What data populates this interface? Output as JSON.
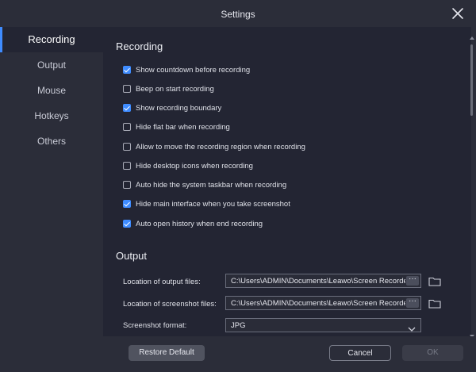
{
  "window": {
    "title": "Settings"
  },
  "sidebar": {
    "items": [
      {
        "label": "Recording",
        "active": true
      },
      {
        "label": "Output"
      },
      {
        "label": "Mouse"
      },
      {
        "label": "Hotkeys"
      },
      {
        "label": "Others"
      }
    ]
  },
  "recording": {
    "title": "Recording",
    "options": [
      {
        "label": "Show countdown before recording",
        "checked": true
      },
      {
        "label": "Beep on start recording",
        "checked": false
      },
      {
        "label": "Show recording boundary",
        "checked": true
      },
      {
        "label": "Hide flat bar when recording",
        "checked": false
      },
      {
        "label": "Allow to move the recording region when recording",
        "checked": false
      },
      {
        "label": "Hide desktop icons when recording",
        "checked": false
      },
      {
        "label": "Auto hide the system taskbar when recording",
        "checked": false
      },
      {
        "label": "Hide main interface when you take screenshot",
        "checked": true
      },
      {
        "label": "Auto open history when end recording",
        "checked": true
      }
    ]
  },
  "output": {
    "title": "Output",
    "output_files_label": "Location of output files:",
    "output_files_value": "C:\\Users\\ADMIN\\Documents\\Leawo\\Screen Recorder",
    "screenshot_files_label": "Location of screenshot files:",
    "screenshot_files_value": "C:\\Users\\ADMIN\\Documents\\Leawo\\Screen Recorder",
    "browse_label": "···",
    "screenshot_format_label": "Screenshot format:",
    "screenshot_format_value": "JPG"
  },
  "footer": {
    "restore_label": "Restore Default",
    "cancel_label": "Cancel",
    "ok_label": "OK"
  },
  "colors": {
    "accent": "#3f8cff",
    "panel_bg": "#232533",
    "window_bg": "#2b2d39"
  }
}
